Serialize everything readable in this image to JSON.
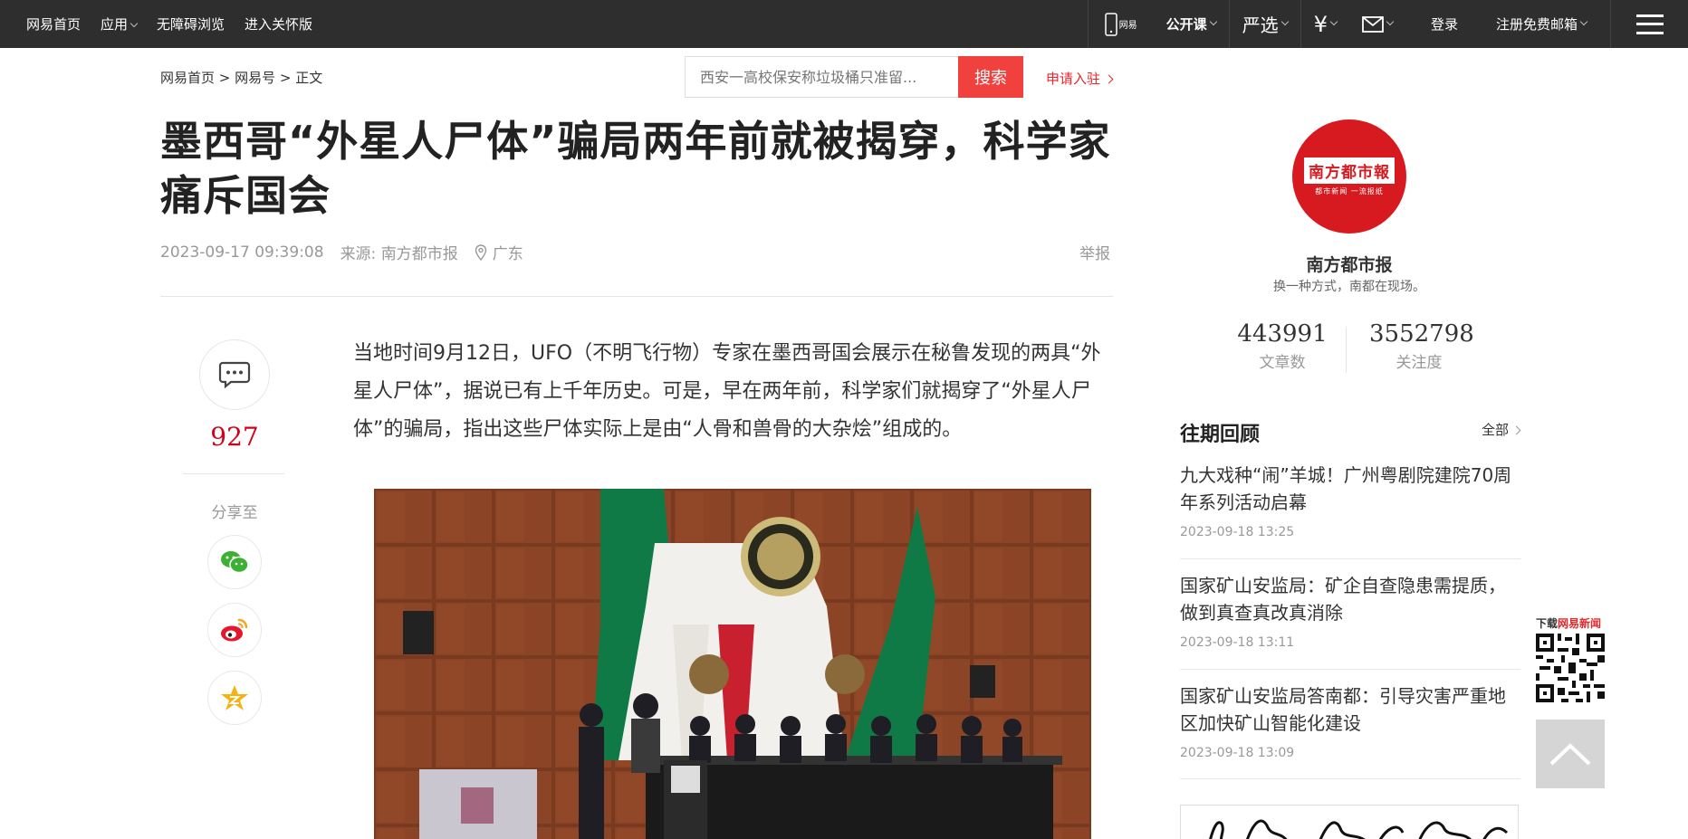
{
  "topbar": {
    "left_links": [
      "网易首页",
      "应用",
      "无障碍浏览",
      "进入关怀版"
    ],
    "right_items": {
      "mobile_label": "网易",
      "open_course": "公开课",
      "yanxuan": "严选",
      "login": "登录",
      "register_email": "注册免费邮箱"
    }
  },
  "breadcrumb": {
    "home": "网易首页",
    "sep1": " > ",
    "channel": "网易号",
    "sep2": " > ",
    "current": "正文"
  },
  "search": {
    "placeholder": "西安一高校保安称垃圾桶只准留...",
    "button_label": "搜索"
  },
  "apply_link": "申请入驻",
  "article": {
    "title": "墨西哥“外星人尸体”骗局两年前就被揭穿，科学家痛斥国会",
    "datetime": "2023-09-17 09:39:08",
    "source": "来源: 南方都市报",
    "location": "广东",
    "report_label": "举报",
    "paragraph": "当地时间9月12日，UFO（不明飞行物）专家在墨西哥国会展示在秘鲁发现的两具“外星人尸体”，据说已有上千年历史。可是，早在两年前，科学家们就揭穿了“外星人尸体”的骗局，指出这些尸体实际上是由“人骨和兽骨的大杂烩”组成的。"
  },
  "share": {
    "comment_count": "927",
    "share_label": "分享至",
    "icons": [
      "wechat-icon",
      "weibo-icon",
      "qzone-icon"
    ]
  },
  "account": {
    "logo_text": "南方都市報",
    "logo_slogan": "都市新闻 一流报纸",
    "name": "南方都市报",
    "description": "换一种方式，南都在现场。",
    "stats": [
      {
        "value": "443991",
        "label": "文章数"
      },
      {
        "value": "3552798",
        "label": "关注度"
      }
    ]
  },
  "past_review": {
    "heading": "往期回顾",
    "all_label": "全部",
    "items": [
      {
        "title": "九大戏种“闹”羊城！广州粤剧院建院70周年系列活动启幕",
        "date": "2023-09-18 13:25"
      },
      {
        "title": "国家矿山安监局：矿企自查隐患需提质，做到真查真改真消除",
        "date": "2023-09-18 13:11"
      },
      {
        "title": "国家矿山安监局答南都：引导灾害严重地区加快矿山智能化建设",
        "date": "2023-09-18 13:09"
      }
    ]
  },
  "download": {
    "prefix": "下载",
    "app_name": "网易新闻"
  },
  "colors": {
    "topbar_bg": "#2e2e2e",
    "accent_red": "#f0413f",
    "brand_red": "#d71920"
  }
}
